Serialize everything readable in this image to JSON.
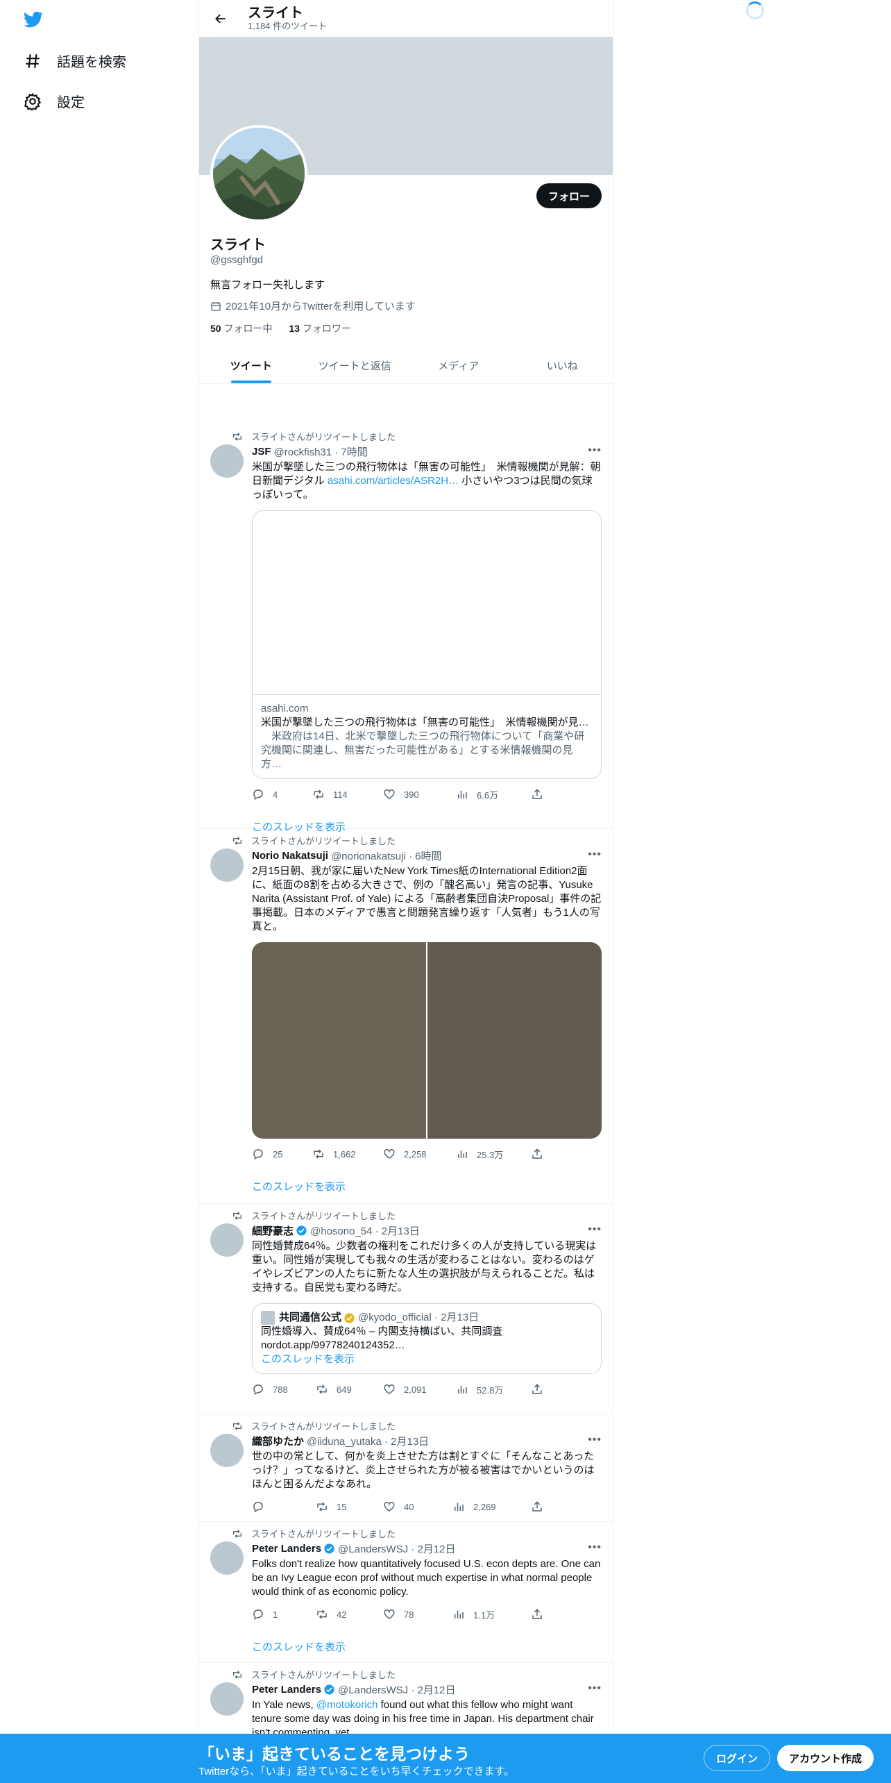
{
  "nav": {
    "explore_label": "話題を検索",
    "settings_label": "設定"
  },
  "header": {
    "title": "スライト",
    "tweet_count": "1,184 件のツイート"
  },
  "profile": {
    "name": "スライト",
    "handle": "@gssghfgd",
    "bio": "無言フォロー失礼します",
    "joined": "2021年10月からTwitterを利用しています",
    "following_count": "50",
    "following_label": "フォロー中",
    "followers_count": "13",
    "followers_label": "フォロワー",
    "follow_button": "フォロー"
  },
  "tabs": [
    "ツイート",
    "ツイートと返信",
    "メディア",
    "いいね"
  ],
  "retweet_label": "スライトさんがリツイートしました",
  "show_thread": "このスレッドを表示",
  "tweets": [
    {
      "name": "JSF",
      "meta": "@rockfish31 · 7時間",
      "text_a": "米国が撃墜した三つの飛行物体は「無害の可能性」　米情報機関が見解：朝日新聞デジタル ",
      "link": "asahi.com/articles/ASR2H…",
      "text_b": " 小さいやつ3つは民間の気球っぽいって。",
      "card_domain": "asahi.com",
      "card_title": "米国が撃墜した三つの飛行物体は「無害の可能性」　米情報機関が見…",
      "card_desc": "　米政府は14日、北米で撃墜した三つの飛行物体について「商業や研究機関に関連し、無害だった可能性がある」とする米情報機関の見方…",
      "replies": "4",
      "retweets": "114",
      "likes": "390",
      "views": "6.6万"
    },
    {
      "name": "Norio Nakatsuji",
      "meta": "@norionakatsuji · 6時間",
      "text": "2月15日朝、我が家に届いたNew York Times紙のInternational Edition2面に、紙面の8割を占める大きさで、例の「醜名高い」発言の記事、Yusuke Narita (Assistant Prof. of Yale) による「高齢者集団自決Proposal」事件の記事掲載。日本のメディアで愚言と問題発言繰り返す「人気者」もう1人の写真と。",
      "replies": "25",
      "retweets": "1,662",
      "likes": "2,258",
      "views": "25.3万"
    },
    {
      "name": "細野豪志",
      "meta": "@hosono_54 · 2月13日",
      "text": "同性婚賛成64％。少数者の権利をこれだけ多くの人が支持している現実は重い。同性婚が実現しても我々の生活が変わることはない。変わるのはゲイやレズビアンの人たちに新たな人生の選択肢が与えられることだ。私は支持する。自民党も変わる時だ。",
      "quote_name": "共同通信公式",
      "quote_meta": "@kyodo_official · 2月13日",
      "quote_text": "同性婚導入、賛成64％ – 内閣支持横ばい、共同調査",
      "quote_link": "nordot.app/99778240124352…",
      "replies": "788",
      "retweets": "649",
      "likes": "2,091",
      "views": "52.8万"
    },
    {
      "name": "織部ゆたか",
      "meta": "@iiduna_yutaka · 2月13日",
      "text": "世の中の常として、何かを炎上させた方は割とすぐに「そんなことあったっけ？」ってなるけど、炎上させられた方が被る被害はでかいというのはほんと困るんだよなあれ。",
      "replies": "",
      "retweets": "15",
      "likes": "40",
      "views": "2,269"
    },
    {
      "name": "Peter Landers",
      "meta": "@LandersWSJ · 2月12日",
      "text": "Folks don't realize how quantitatively focused U.S. econ depts are. One can be an Ivy League econ prof without much expertise in what normal people would think of as economic policy.",
      "replies": "1",
      "retweets": "42",
      "likes": "78",
      "views": "1.1万"
    },
    {
      "name": "Peter Landers",
      "meta": "@LandersWSJ · 2月12日",
      "text_a": "In Yale news, ",
      "mention": "@motokorich",
      "text_b": " found out what this fellow who might want tenure some day was doing in his free time in Japan. His department chair isn't commenting, yet."
    }
  ],
  "bottom": {
    "title": "「いま」起きていることを見つけよう",
    "subtitle": "Twitterなら、「いま」起きていることをいち早くチェックできます。",
    "login": "ログイン",
    "signup": "アカウント作成"
  },
  "colors": {
    "accent": "#1d9bf0",
    "banner": "#cfd9de",
    "text": "#0f1419",
    "muted": "#536471"
  }
}
